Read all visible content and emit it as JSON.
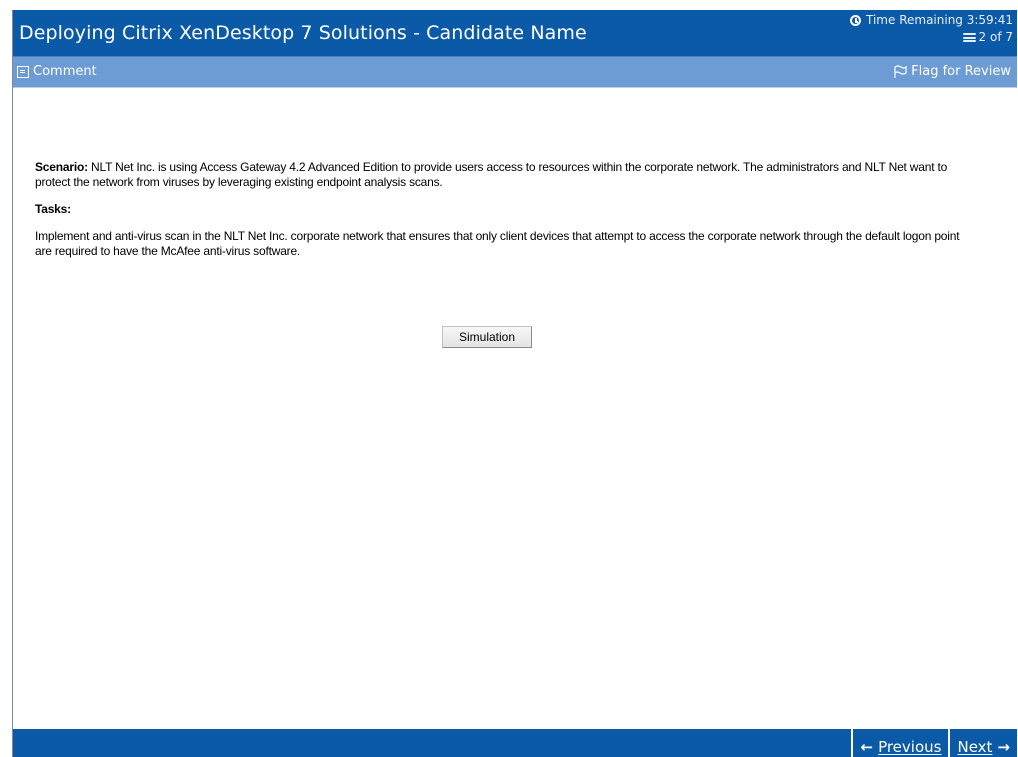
{
  "app": {
    "title": "Deploying Citrix XenDesktop 7 Solutions - Candidate Name"
  },
  "status": {
    "time_label": "Time Remaining 3:59:41",
    "page_indicator": "2 of 7",
    "clock_icon": "clock-icon",
    "pages_icon": "pages-icon"
  },
  "toolbar": {
    "comment_label": "Comment",
    "comment_icon": "comment-icon",
    "flag_label": "Flag for Review",
    "flag_icon": "flag-icon"
  },
  "question": {
    "scenario_label": "Scenario:",
    "scenario_text": "NLT Net Inc. is using Access Gateway 4.2 Advanced Edition to provide users access to resources within the corporate network. The administrators and NLT Net want to protect the network from viruses by leveraging existing endpoint analysis scans.",
    "tasks_label": "Tasks:",
    "tasks_text": "Implement and anti-virus scan in the NLT Net Inc. corporate network that ensures that only client devices that attempt to access the corporate network through the default logon point are required to have the McAfee  anti-virus software.",
    "simulation_button": "Simulation"
  },
  "navigation": {
    "previous_label": "Previous",
    "next_label": "Next",
    "previous_icon": "arrow-left-icon",
    "next_icon": "arrow-right-icon"
  },
  "colors": {
    "title_bar": "#0b5aa8",
    "toolbar": "#6d9bd4",
    "footer": "#0b5aa8"
  }
}
